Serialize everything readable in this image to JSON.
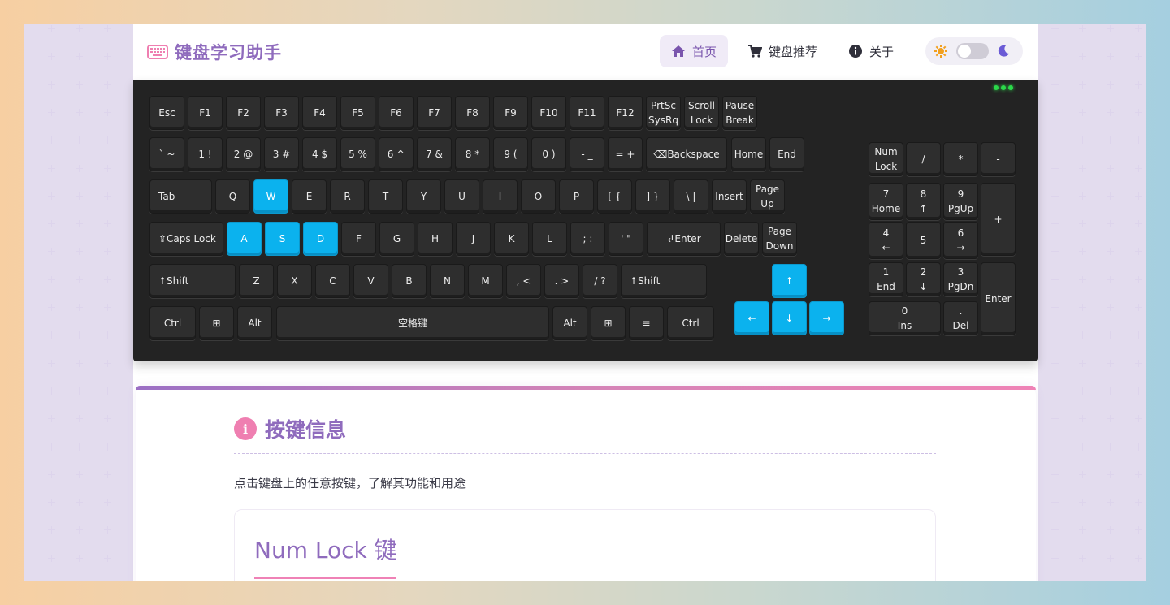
{
  "app": {
    "title": "键盘学习助手"
  },
  "nav": {
    "items": [
      {
        "label": "首页",
        "icon": "home-icon",
        "active": true
      },
      {
        "label": "键盘推荐",
        "icon": "cart-icon",
        "active": false
      },
      {
        "label": "关于",
        "icon": "info-icon",
        "active": false
      }
    ]
  },
  "theme": {
    "light_icon": "sun-icon",
    "dark_icon": "moon-icon",
    "dark_mode": false
  },
  "colors": {
    "accent": "#8f6bbd",
    "highlight_key": "#0bb2ee",
    "keyboard_bg": "#232323",
    "pink": "#ef82b6"
  },
  "keyboard": {
    "row0": [
      "Esc",
      "F1",
      "F2",
      "F3",
      "F4",
      "F5",
      "F6",
      "F7",
      "F8",
      "F9",
      "F10",
      "F11",
      "F12"
    ],
    "row0_extra": [
      [
        "PrtSc",
        "SysRq"
      ],
      [
        "Scroll",
        "Lock"
      ],
      [
        "Pause",
        "Break"
      ]
    ],
    "row1": [
      "` ~",
      "1 !",
      "2 @",
      "3 #",
      "4 $",
      "5 %",
      "6 ^",
      "7 &",
      "8 *",
      "9 (",
      "0 )",
      "- _",
      "= +",
      "⌫Backspace"
    ],
    "row2": [
      "Tab",
      "Q",
      "W",
      "E",
      "R",
      "T",
      "Y",
      "U",
      "I",
      "O",
      "P",
      "[ {",
      "] }",
      "\\ |"
    ],
    "row3": [
      "⇪Caps Lock",
      "A",
      "S",
      "D",
      "F",
      "G",
      "H",
      "J",
      "K",
      "L",
      "; :",
      "' \"",
      "↲Enter"
    ],
    "row4": [
      "↑Shift",
      "Z",
      "X",
      "C",
      "V",
      "B",
      "N",
      "M",
      ", <",
      ". >",
      "/ ?",
      "↑Shift"
    ],
    "row5": [
      "Ctrl",
      "⊞",
      "Alt",
      "空格键",
      "Alt",
      "⊞",
      "≡",
      "Ctrl"
    ],
    "nav_cluster": {
      "insert": "Insert",
      "home": "Home",
      "end": "End",
      "pgup": [
        "Page",
        "Up"
      ],
      "delete": "Delete",
      "pgdn": [
        "Page",
        "Down"
      ]
    },
    "arrows": {
      "up": "↑",
      "left": "←",
      "down": "↓",
      "right": "→"
    },
    "numpad": {
      "numlock": [
        "Num",
        "Lock"
      ],
      "div": "/",
      "mul": "*",
      "sub": "-",
      "n7": [
        "7",
        "Home"
      ],
      "n8": [
        "8",
        "↑"
      ],
      "n9": [
        "9",
        "PgUp"
      ],
      "add": "+",
      "n4": [
        "4",
        "←"
      ],
      "n5": "5",
      "n6": [
        "6",
        "→"
      ],
      "n1": [
        "1",
        "End"
      ],
      "n2": [
        "2",
        "↓"
      ],
      "n3": [
        "3",
        "PgDn"
      ],
      "enter": "Enter",
      "n0": [
        "0",
        "Ins"
      ],
      "dot": [
        ".",
        "Del"
      ]
    },
    "highlighted": [
      "W",
      "A",
      "S",
      "D",
      "↑",
      "←",
      "↓",
      "→"
    ]
  },
  "info": {
    "title": "按键信息",
    "description": "点击键盘上的任意按键，了解其功能和用途",
    "key_title": "Num Lock 键"
  }
}
